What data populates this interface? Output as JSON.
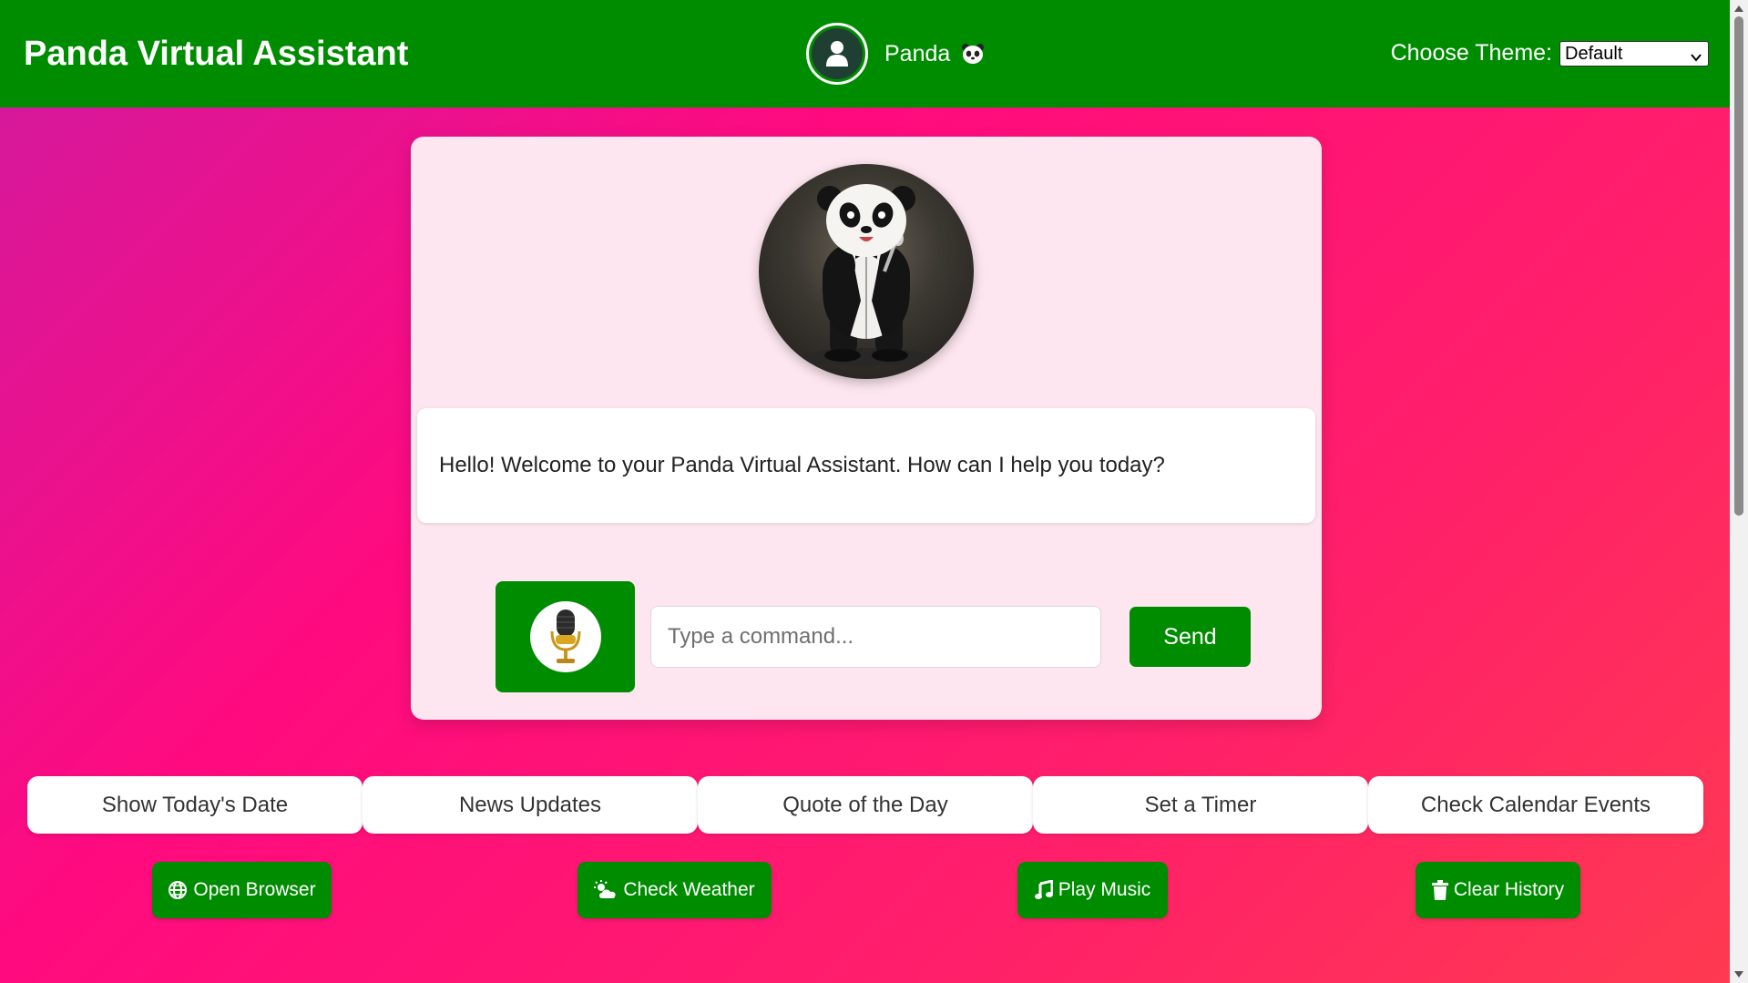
{
  "header": {
    "title": "Panda Virtual Assistant",
    "profile_name": "Panda",
    "theme_label": "Choose Theme:",
    "theme_value": "Default"
  },
  "assistant": {
    "greeting": "Hello! Welcome to your Panda Virtual Assistant. How can I help you today?",
    "input_placeholder": "Type a command...",
    "input_value": "",
    "send_label": "Send"
  },
  "quick_actions": [
    {
      "label": "Show Today's Date"
    },
    {
      "label": "News Updates"
    },
    {
      "label": "Quote of the Day"
    },
    {
      "label": "Set a Timer"
    },
    {
      "label": "Check Calendar Events"
    }
  ],
  "tools": [
    {
      "label": "Open Browser",
      "icon": "globe-icon"
    },
    {
      "label": "Check Weather",
      "icon": "cloud-sun-icon"
    },
    {
      "label": "Play Music",
      "icon": "music-note-icon"
    },
    {
      "label": "Clear History",
      "icon": "trash-icon"
    }
  ],
  "colors": {
    "header_green": "#008c00",
    "button_green": "#008c00",
    "background_pink": "#ff0a7f",
    "card_pink": "#fde6ef"
  }
}
